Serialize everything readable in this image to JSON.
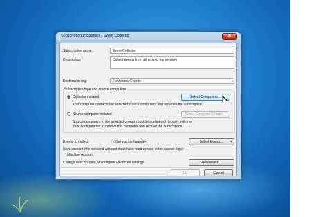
{
  "window": {
    "title": "Subscription Properties - Event Collector",
    "close_glyph": "✕"
  },
  "form": {
    "subscription_name_label": "Subscription name:",
    "subscription_name_value": "Event Collector",
    "description_label": "Description:",
    "description_value": "Collect events from all around my network",
    "destination_log_label": "Destination log:",
    "destination_log_value": "Forwarded Events",
    "subscription_type_label": "Subscription type and source computers",
    "collector_initiated_label": "Collector initiated",
    "collector_initiated_selected": true,
    "collector_initiated_help": "This computer contacts the selected source computers and provides the subscription.",
    "select_computers_button": "Select Computers...",
    "source_initiated_label": "Source computer initiated",
    "source_initiated_selected": false,
    "select_computer_groups_button": "Select Computer Groups...",
    "source_initiated_help_line1": "Source computers in the selected groups must be configured through policy or",
    "source_initiated_help_line2": "local configuration to contact this computer and receive the subscription.",
    "events_to_collect_label": "Events to collect:",
    "events_filter_value": "<filter not configured>",
    "select_events_button": "Select Events...",
    "user_account_label": "User account (the selected account must have read access to the source logs):",
    "user_account_value": "Machine Account",
    "advanced_label": "Change user account or configure advanced settings:",
    "advanced_button": "Advanced...",
    "ok_button": "OK",
    "cancel_button": "Cancel"
  },
  "icons": {
    "dropdown_arrow": "▾",
    "close": "close-icon",
    "cursor": "mouse-pointer-icon"
  },
  "colors": {
    "desktop_blue": "#1f7fcf",
    "close_red": "#c9462f",
    "dialog_bg": "#f0f0f0"
  }
}
